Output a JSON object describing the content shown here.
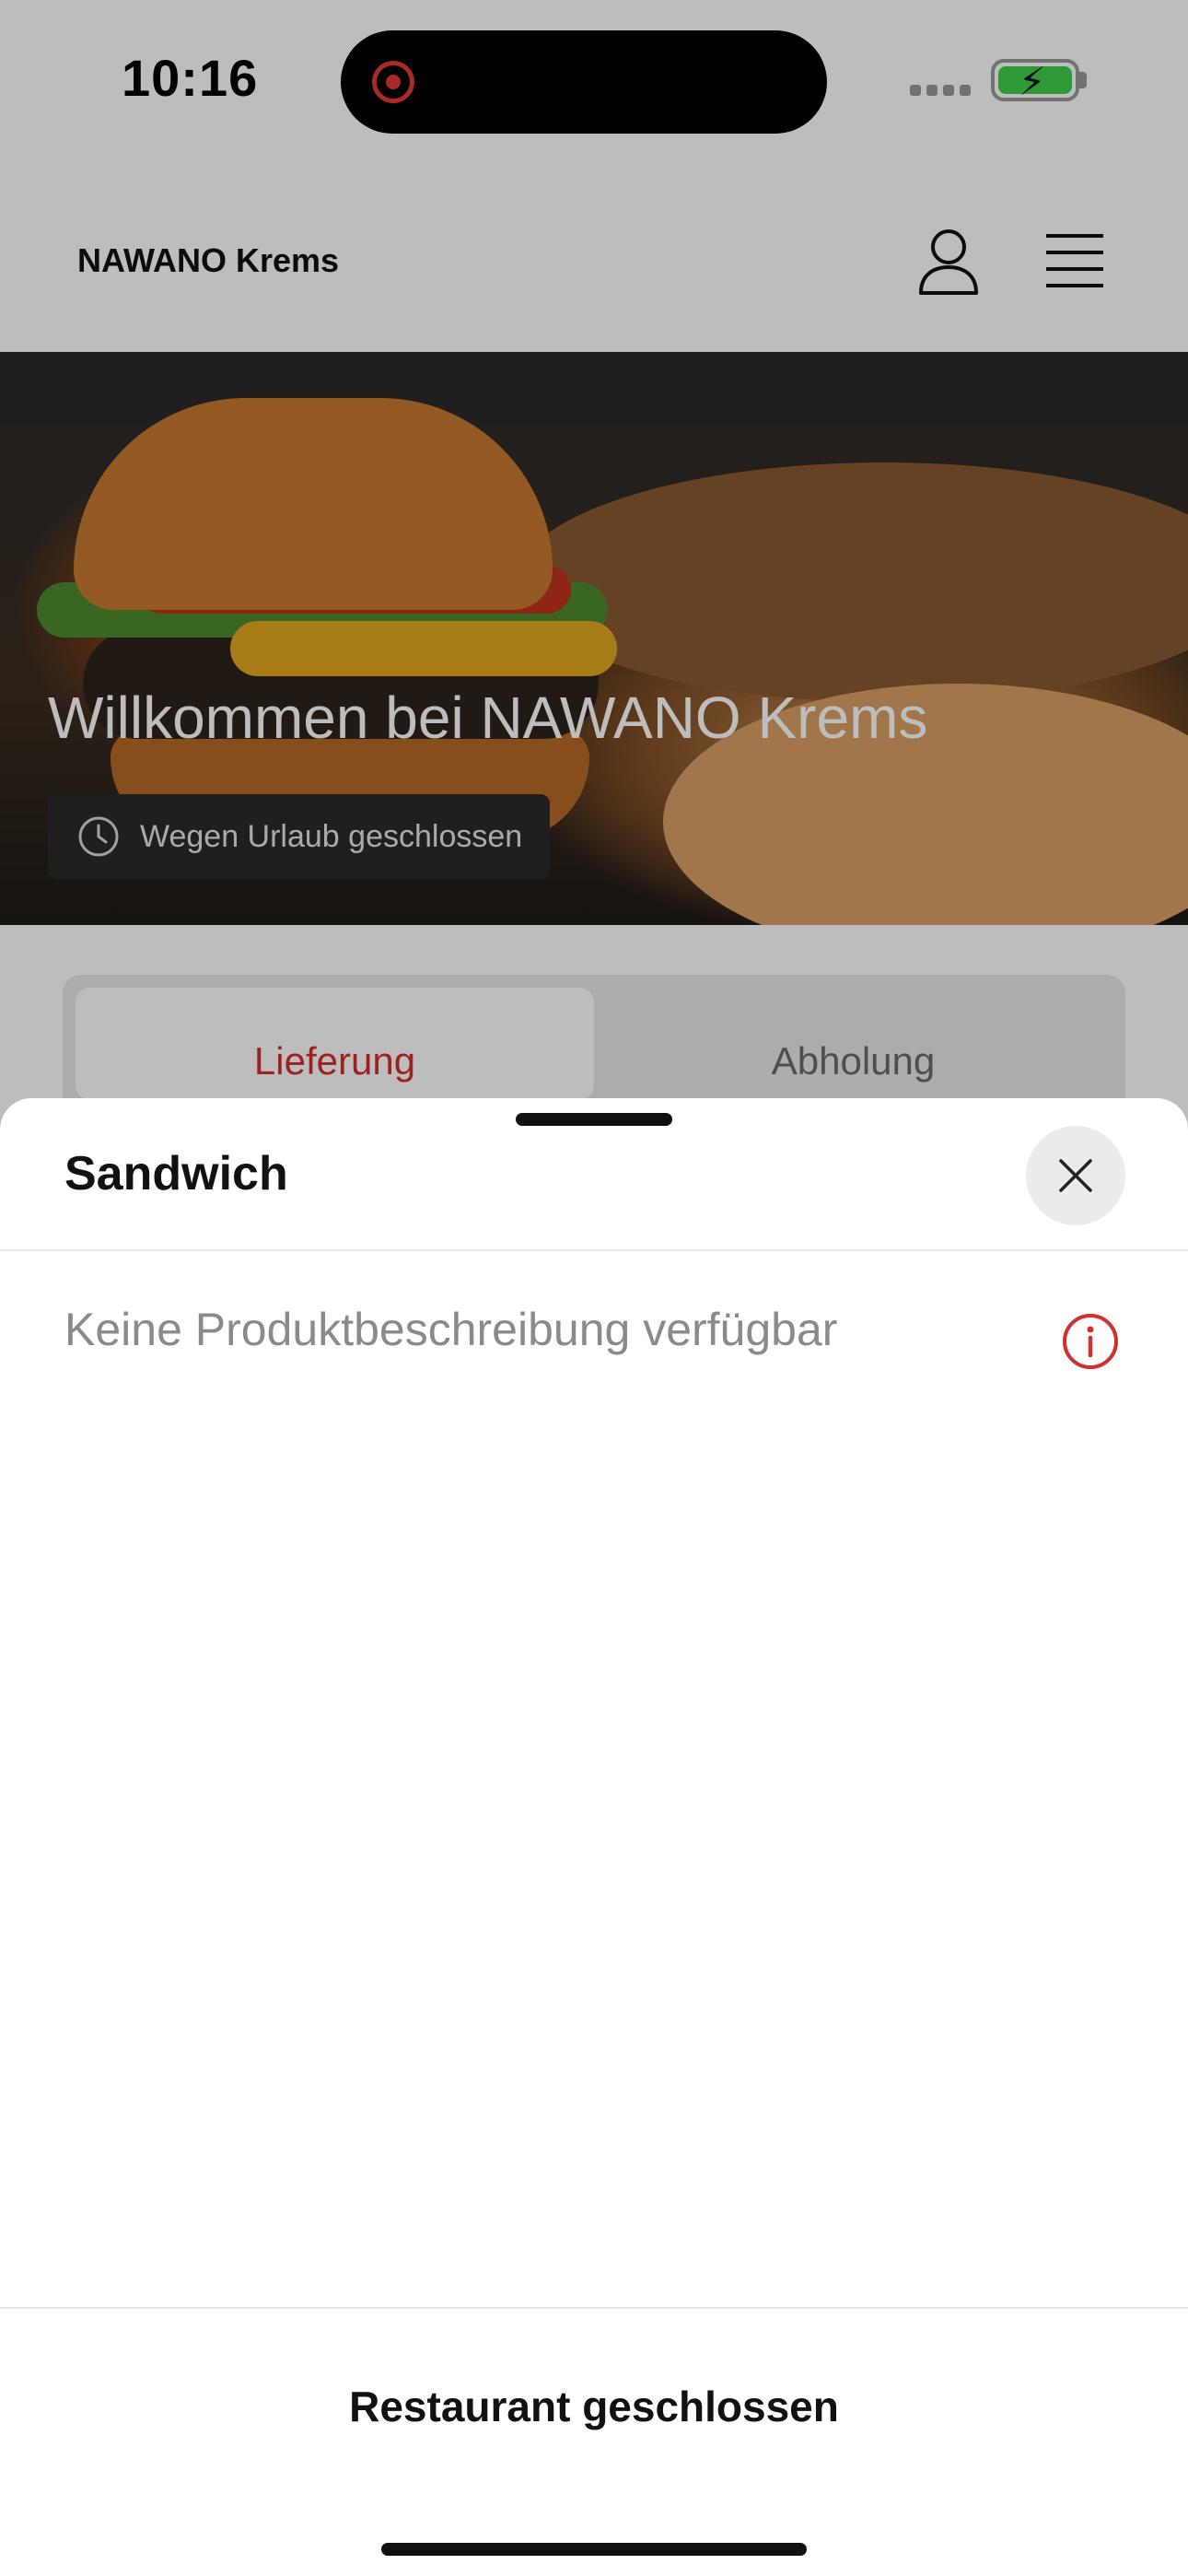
{
  "status_bar": {
    "time": "10:16",
    "icons": [
      "screen-record-icon",
      "signal-icon",
      "battery-charging-icon"
    ]
  },
  "header": {
    "brand": "NAWANO Krems",
    "icons": [
      "user-icon",
      "menu-icon"
    ]
  },
  "hero": {
    "title": "Willkommen bei NAWANO Krems",
    "status_badge": "Wegen Urlaub geschlossen",
    "status_icon": "clock-icon"
  },
  "order_type_tabs": [
    {
      "label": "Lieferung",
      "active": true
    },
    {
      "label": "Abholung",
      "active": false
    }
  ],
  "product_sheet": {
    "title": "Sandwich",
    "description": "Keine Produktbeschreibung verfügbar",
    "info_icon": "info-icon",
    "close_icon": "close-icon",
    "footer_button": "Restaurant geschlossen"
  },
  "colors": {
    "accent": "#d32f2f",
    "battery": "#3ecf4a",
    "overlay": "rgba(0,0,0,0.26)"
  }
}
